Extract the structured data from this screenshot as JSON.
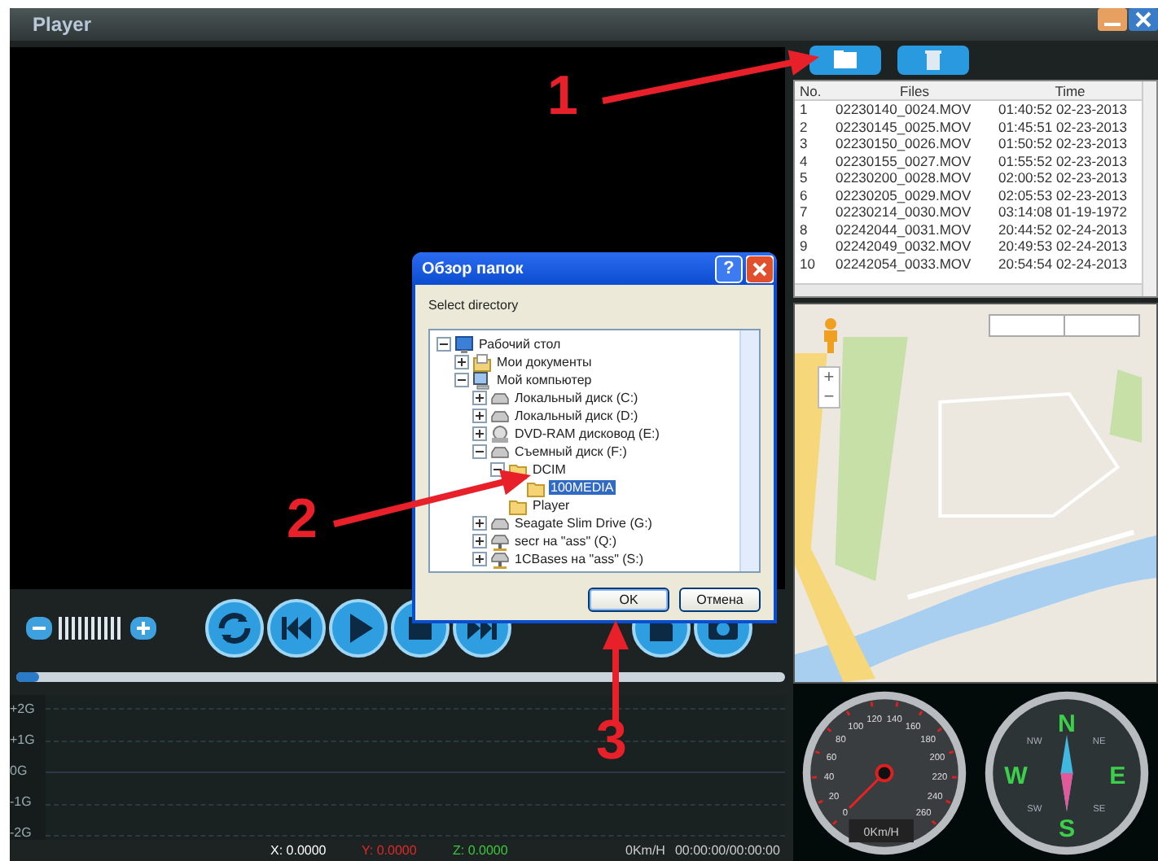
{
  "window": {
    "title": "Player"
  },
  "volume": {
    "level": 1
  },
  "progress": {
    "level": 0.03
  },
  "gsensor": {
    "axis_labels": [
      "+2G",
      "+1G",
      "0G",
      "-1G",
      "-2G"
    ]
  },
  "status_bar": {
    "axes": [
      {
        "text": "X: 0.0000",
        "color": "#ffffff"
      },
      {
        "text": "Y: 0.0000",
        "color": "#e02828"
      },
      {
        "text": "Z: 0.0000",
        "color": "#3cc83c"
      }
    ],
    "speed": "0Km/H",
    "time": "00:00:00/00:00:00"
  },
  "file_table": {
    "columns": [
      "No.",
      "Files",
      "Time"
    ],
    "rows": [
      [
        "1",
        "02230140_0024.MOV",
        "01:40:52 02-23-2013"
      ],
      [
        "2",
        "02230145_0025.MOV",
        "01:45:51 02-23-2013"
      ],
      [
        "3",
        "02230150_0026.MOV",
        "01:50:52 02-23-2013"
      ],
      [
        "4",
        "02230155_0027.MOV",
        "01:55:52 02-23-2013"
      ],
      [
        "5",
        "02230200_0028.MOV",
        "02:00:52 02-23-2013"
      ],
      [
        "6",
        "02230205_0029.MOV",
        "02:05:53 02-23-2013"
      ],
      [
        "7",
        "02230214_0030.MOV",
        "03:14:08 01-19-1972"
      ],
      [
        "8",
        "02242044_0031.MOV",
        "20:44:52 02-24-2013"
      ],
      [
        "9",
        "02242049_0032.MOV",
        "20:49:53 02-24-2013"
      ],
      [
        "10",
        "02242054_0033.MOV",
        "20:54:54 02-24-2013"
      ]
    ]
  },
  "map": {
    "zoom_in": "+",
    "zoom_out": "−"
  },
  "speedometer": {
    "ticks": [
      "0",
      "20",
      "40",
      "60",
      "80",
      "100",
      "120",
      "140",
      "160",
      "180",
      "200",
      "220",
      "240",
      "260"
    ],
    "reading": "0Km/H"
  },
  "compass": {
    "cardinals": [
      "N",
      "E",
      "S",
      "W"
    ],
    "intercardinals": [
      "NW",
      "NE",
      "SW",
      "SE"
    ]
  },
  "dialog": {
    "title": "Обзор папок",
    "help": "?",
    "prompt": "Select directory",
    "ok": "OK",
    "cancel": "Отмена",
    "tree": [
      {
        "label": "Рабочий стол",
        "kind": "desktop",
        "expanded": true,
        "selected": false,
        "children": [
          {
            "label": "Мои документы",
            "kind": "documents",
            "expanded": false,
            "selected": false
          },
          {
            "label": "Мой компьютер",
            "kind": "computer",
            "expanded": true,
            "selected": false,
            "children": [
              {
                "label": "Локальный диск (C:)",
                "kind": "disk",
                "expanded": false,
                "selected": false
              },
              {
                "label": "Локальный диск (D:)",
                "kind": "disk",
                "expanded": false,
                "selected": false
              },
              {
                "label": "DVD-RAM дисковод (E:)",
                "kind": "dvd",
                "expanded": false,
                "selected": false
              },
              {
                "label": "Съемный диск (F:)",
                "kind": "disk",
                "expanded": true,
                "selected": false,
                "children": [
                  {
                    "label": "DCIM",
                    "kind": "folder",
                    "expanded": true,
                    "selected": false,
                    "children": [
                      {
                        "label": "100MEDIA",
                        "kind": "folder",
                        "selected": true
                      }
                    ]
                  },
                  {
                    "label": "Player",
                    "kind": "folder",
                    "selected": false
                  }
                ]
              },
              {
                "label": "Seagate Slim Drive (G:)",
                "kind": "disk",
                "expanded": false,
                "selected": false
              },
              {
                "label": "secr на \"ass\" (Q:)",
                "kind": "network",
                "expanded": false,
                "selected": false
              },
              {
                "label": "1CBases на \"ass\" (S:)",
                "kind": "network",
                "expanded": false,
                "selected": false
              }
            ]
          }
        ]
      }
    ]
  },
  "annotations": [
    {
      "label": "1"
    },
    {
      "label": "2"
    },
    {
      "label": "3"
    }
  ]
}
